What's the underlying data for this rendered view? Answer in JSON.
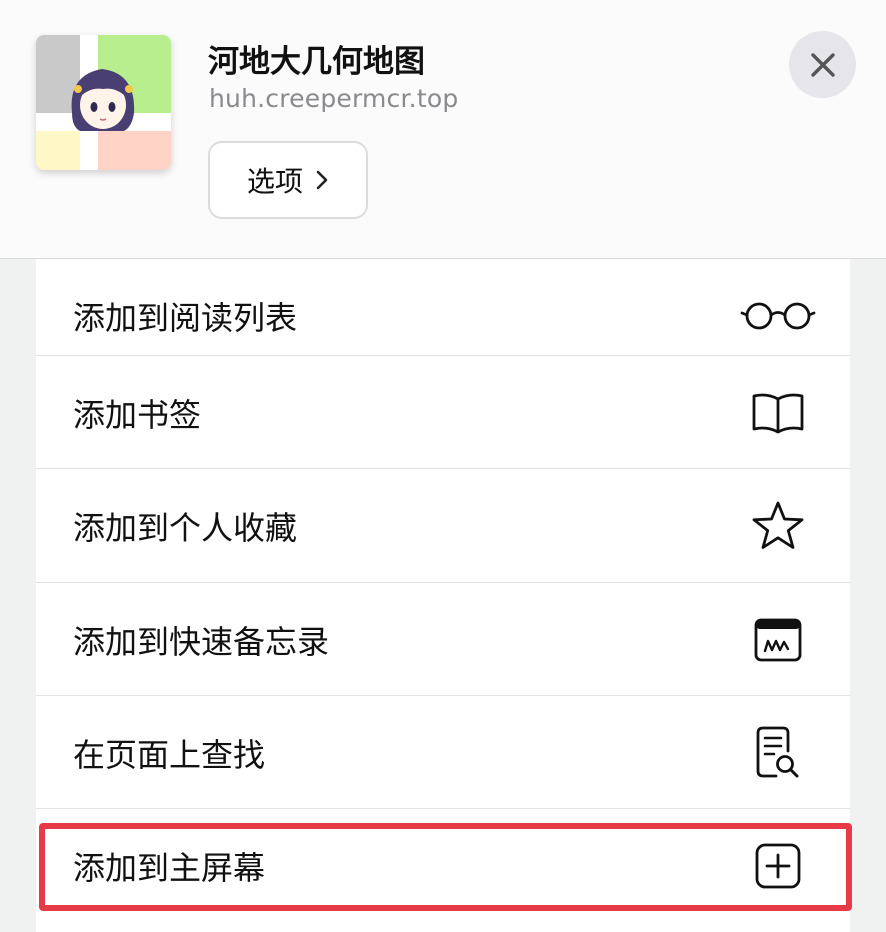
{
  "header": {
    "site_title": "河地大几何地图",
    "site_url": "huh.creepermcr.top",
    "options_label": "选项",
    "thumbnail_colors": {
      "top_left": "#c9c9c9",
      "top_right": "#b9ee8e",
      "bottom_left": "#fff7c5",
      "bottom_right": "#ffd4c7",
      "cross": "#ffffff"
    }
  },
  "menu": {
    "items": [
      {
        "label": "添加到阅读列表",
        "icon": "glasses-icon"
      },
      {
        "label": "添加书签",
        "icon": "book-icon"
      },
      {
        "label": "添加到个人收藏",
        "icon": "star-icon"
      },
      {
        "label": "添加到快速备忘录",
        "icon": "quick-note-icon"
      },
      {
        "label": "在页面上查找",
        "icon": "find-on-page-icon"
      },
      {
        "label": "添加到主屏幕",
        "icon": "add-square-icon"
      }
    ],
    "highlight_color": "#e63a46"
  }
}
